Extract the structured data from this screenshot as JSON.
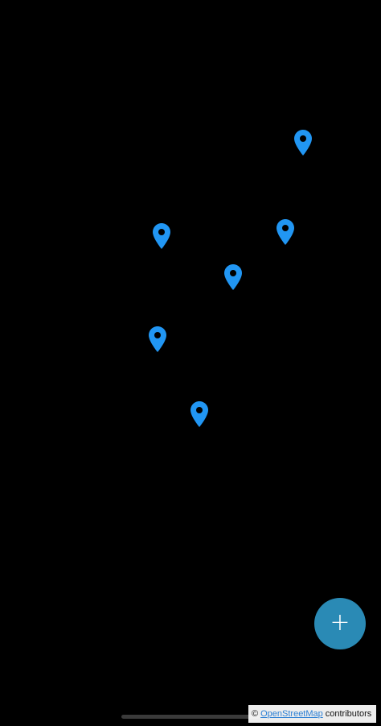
{
  "map": {
    "background": "#000000",
    "markers": [
      {
        "icon": "map-pin-icon",
        "color": "#2196F3"
      },
      {
        "icon": "map-pin-icon",
        "color": "#2196F3"
      },
      {
        "icon": "map-pin-icon",
        "color": "#2196F3"
      },
      {
        "icon": "map-pin-icon",
        "color": "#2196F3"
      },
      {
        "icon": "map-pin-icon",
        "color": "#2196F3"
      },
      {
        "icon": "map-pin-icon",
        "color": "#2196F3"
      }
    ]
  },
  "fab": {
    "label": "+",
    "icon": "plus-icon",
    "color": "#2A8AB5"
  },
  "attribution": {
    "copyright": "©",
    "link_text": "OpenStreetMap",
    "suffix": "contributors",
    "link_color": "#2b7fd4"
  }
}
